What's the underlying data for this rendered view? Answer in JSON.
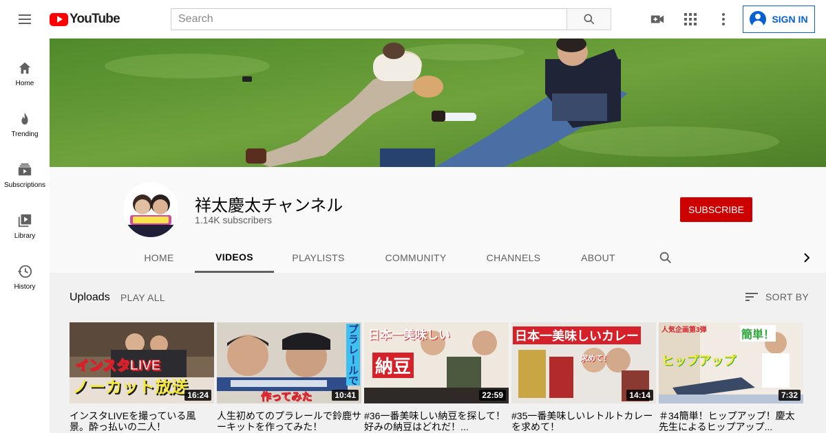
{
  "masthead": {
    "logo_text": "YouTube",
    "search_placeholder": "Search",
    "signin_label": "SIGN IN"
  },
  "guide": {
    "items": [
      {
        "label": "Home",
        "icon": "home-icon"
      },
      {
        "label": "Trending",
        "icon": "flame-icon"
      },
      {
        "label": "Subscriptions",
        "icon": "subscriptions-icon"
      },
      {
        "label": "Library",
        "icon": "library-icon"
      },
      {
        "label": "History",
        "icon": "history-icon"
      }
    ]
  },
  "channel": {
    "name": "祥太慶太チャンネル",
    "subscribers": "1.14K subscribers",
    "subscribe_label": "SUBSCRIBE",
    "avatar_text": "しぶ缶 慶太"
  },
  "tabs": [
    {
      "label": "HOME",
      "active": false
    },
    {
      "label": "VIDEOS",
      "active": true
    },
    {
      "label": "PLAYLISTS",
      "active": false
    },
    {
      "label": "COMMUNITY",
      "active": false
    },
    {
      "label": "CHANNELS",
      "active": false
    },
    {
      "label": "ABOUT",
      "active": false
    }
  ],
  "section": {
    "title": "Uploads",
    "play_all": "PLAY ALL",
    "sort_by": "SORT BY"
  },
  "videos": [
    {
      "title": "インスタLIVEを撮っている風景。酔っ払いの二人！",
      "duration": "16:24",
      "overlay_top": "インスタLIVE",
      "overlay_bottom": "ノーカット放送"
    },
    {
      "title": "人生初めてのプラレールで鈴鹿サーキットを作ってみた！",
      "duration": "10:41",
      "overlay_top": "プラレールで",
      "overlay_bottom": "作ってみた"
    },
    {
      "title": "#36一番美味しい納豆を探して！好みの納豆はどれだ！...",
      "duration": "22:59",
      "overlay_top": "日本一美味しい",
      "overlay_bottom": "納豆"
    },
    {
      "title": "#35一番美味しいレトルトカレーを求めて！",
      "duration": "14:14",
      "overlay_top": "日本一美味しいカレー",
      "overlay_bottom": "求めて！"
    },
    {
      "title": "＃34簡単！ヒップアップ！慶太先生によるヒップアップ...",
      "duration": "7:32",
      "overlay_top": "簡単！",
      "overlay_bottom": "ヒップアップ"
    }
  ],
  "colors": {
    "brand_red": "#ff0000",
    "subscribe_red": "#cc0000",
    "signin_blue": "#065fd4"
  }
}
